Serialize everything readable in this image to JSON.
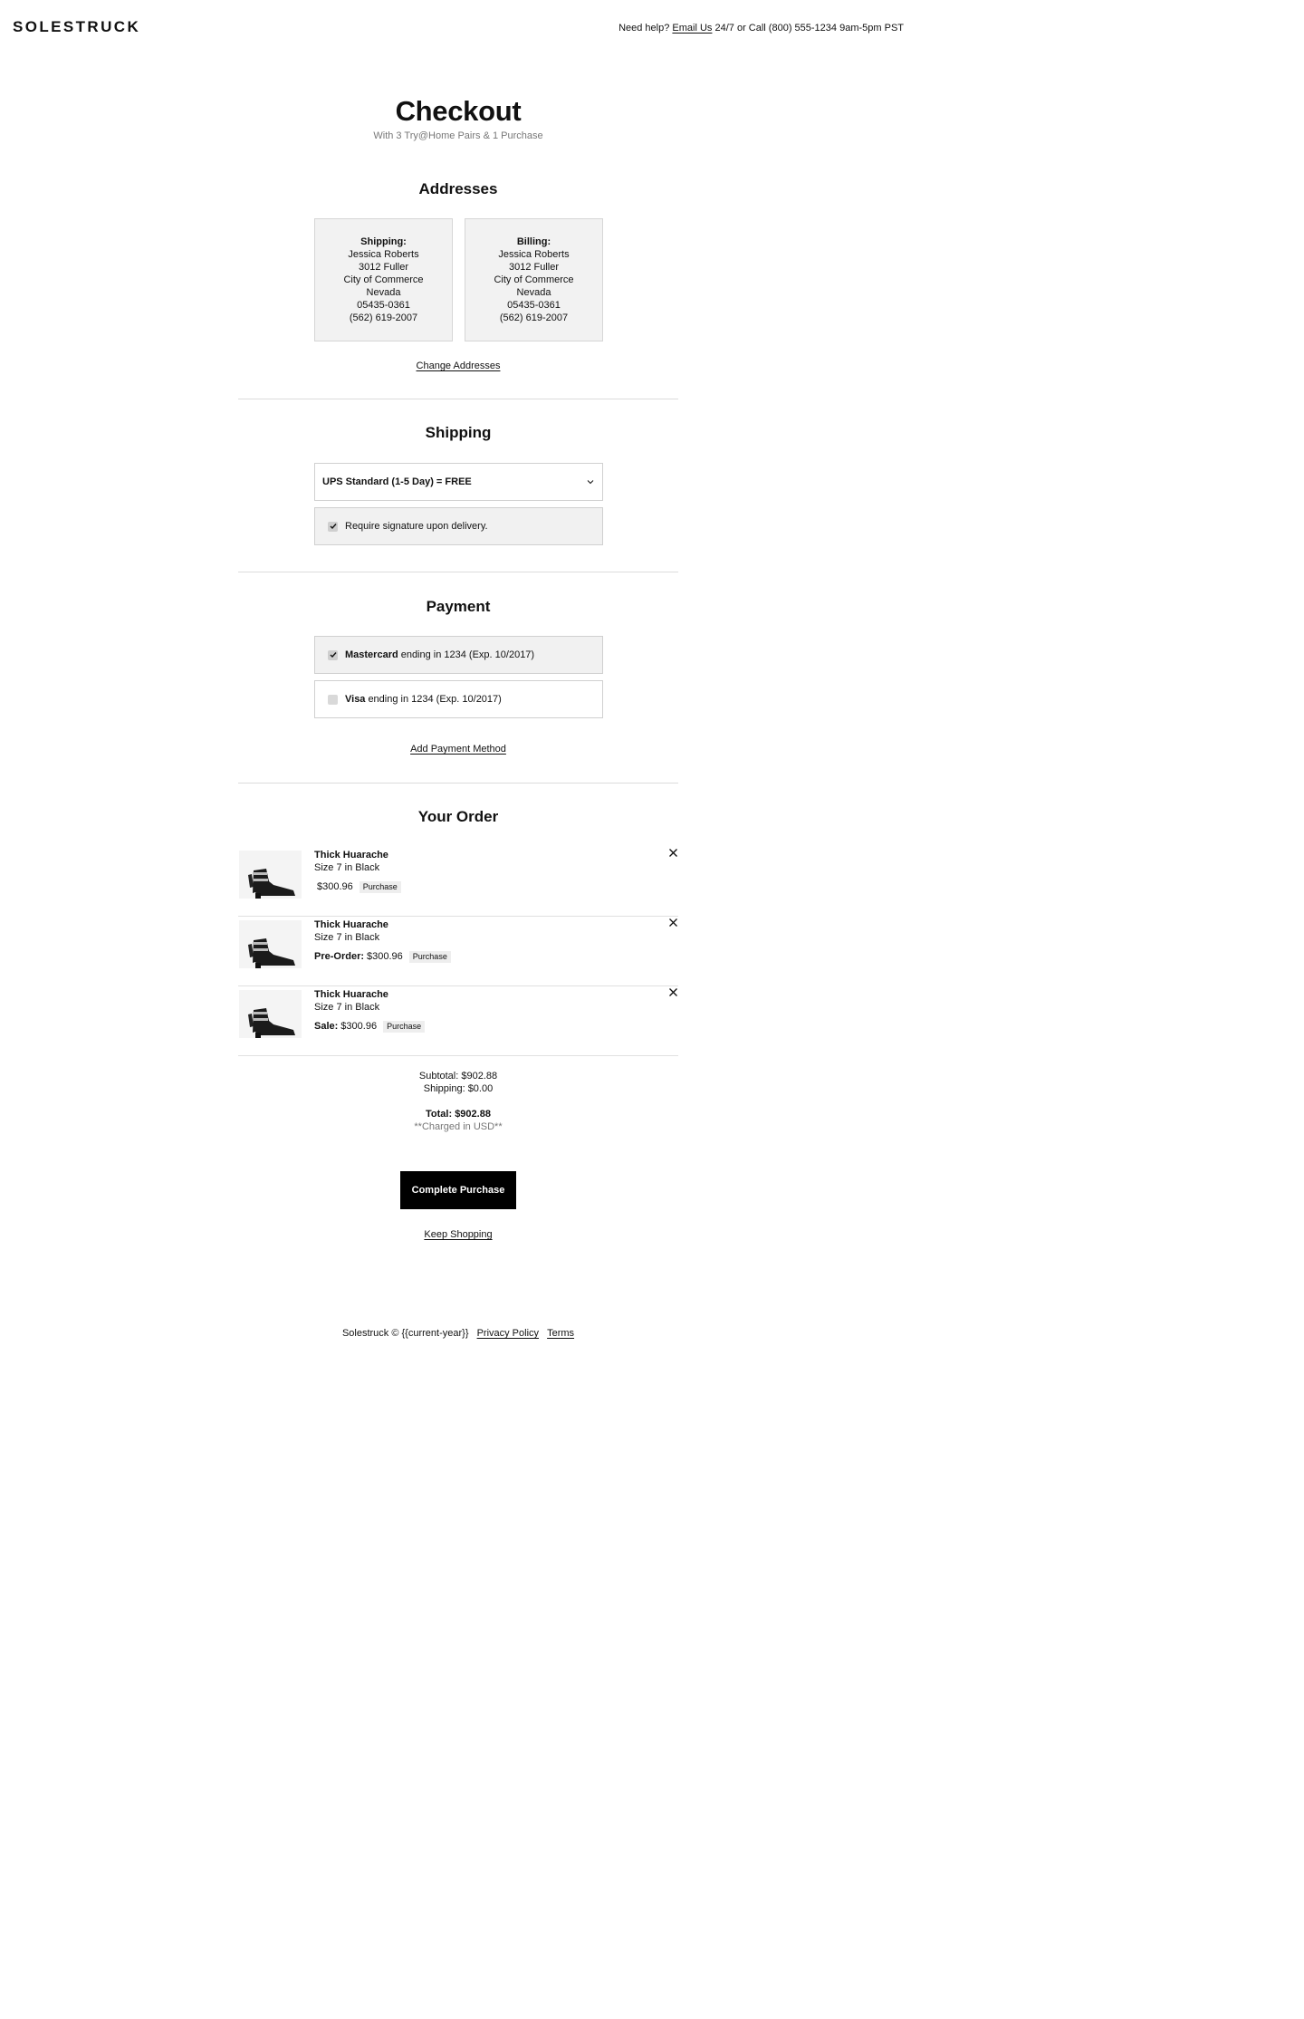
{
  "header": {
    "logo": "SOLESTRUCK",
    "help_prefix": "Need help?",
    "help_email": "Email Us",
    "help_suffix": "24/7 or Call (800) 555-1234 9am-5pm PST"
  },
  "page": {
    "title": "Checkout",
    "subtitle": "With 3 Try@Home Pairs & 1 Purchase"
  },
  "addresses": {
    "title": "Addresses",
    "shipping": {
      "label": "Shipping:",
      "name": "Jessica Roberts",
      "street": "3012 Fuller",
      "city": "City of Commerce",
      "state": "Nevada",
      "zip": "05435-0361",
      "phone": "(562) 619-2007"
    },
    "billing": {
      "label": "Billing:",
      "name": "Jessica Roberts",
      "street": "3012 Fuller",
      "city": "City of Commerce",
      "state": "Nevada",
      "zip": "05435-0361",
      "phone": "(562) 619-2007"
    },
    "change_link": "Change Addresses"
  },
  "shipping": {
    "title": "Shipping",
    "selected_method": "UPS Standard (1-5 Day) = FREE",
    "signature_label": "Require signature upon delivery.",
    "signature_checked": true
  },
  "payment": {
    "title": "Payment",
    "methods": [
      {
        "brand": "Mastercard",
        "detail": "ending in 1234 (Exp. 10/2017)",
        "selected": true
      },
      {
        "brand": "Visa",
        "detail": "ending in 1234 (Exp. 10/2017)",
        "selected": false
      }
    ],
    "add_link": "Add Payment Method"
  },
  "order": {
    "title": "Your Order",
    "items": [
      {
        "name": "Thick Huarache",
        "variant": "Size 7 in Black",
        "price_prefix": "",
        "price": "$300.96",
        "badge": "Purchase"
      },
      {
        "name": "Thick Huarache",
        "variant": "Size 7 in Black",
        "price_prefix": "Pre-Order:",
        "price": "$300.96",
        "badge": "Purchase"
      },
      {
        "name": "Thick Huarache",
        "variant": "Size 7 in Black",
        "price_prefix": "Sale:",
        "price": "$300.96",
        "badge": "Purchase"
      }
    ]
  },
  "totals": {
    "subtotal": "Subtotal: $902.88",
    "shipping": "Shipping: $0.00",
    "total": "Total: $902.88",
    "currency_note": "**Charged in USD**"
  },
  "actions": {
    "complete": "Complete Purchase",
    "keep_shopping": "Keep Shopping"
  },
  "footer": {
    "copyright": "Solestruck © {{current-year}}",
    "privacy": "Privacy Policy",
    "terms": "Terms"
  }
}
